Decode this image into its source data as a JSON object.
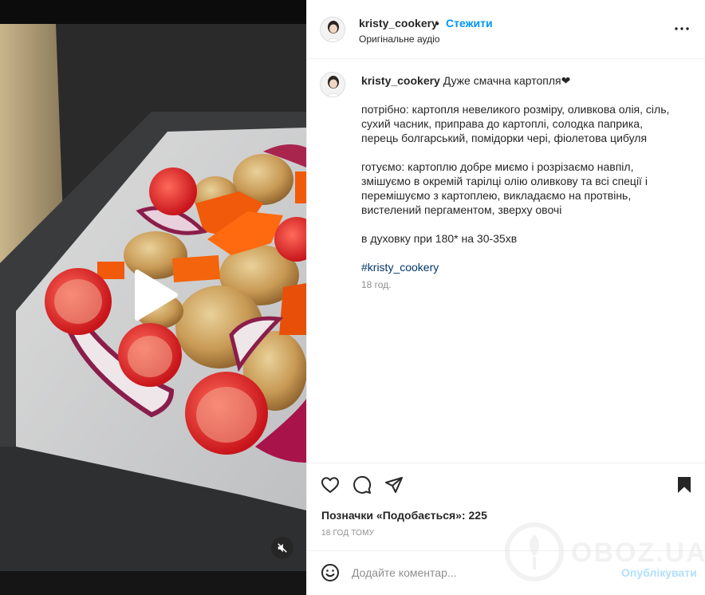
{
  "post": {
    "username": "kristy_cookery",
    "separator": "•",
    "follow_label": "Стежити",
    "audio_label": "Оригінальне аудіо",
    "more_icon": "more-horizontal-icon"
  },
  "caption": {
    "username": "kristy_cookery",
    "title": "Дуже смачна картопля❤",
    "ingredients": "потрібно: картопля невеликого розміру, оливкова олія, сіль, сухий часник, приправа до картоплі, солодка паприка, перець болгарський, помідорки черрі, фіолетова цибуля",
    "ingredients_display": "потрібно: картопля невеликого розміру, оливкова олія, сіль, сухий часник, приправа до картоплі, солодка паприка, перець болгарський, помідорки чері, фіолетова цибуля",
    "method": "готуємо: картоплю добре миємо і розрізаємо навпіл, змішуємо в окремій тарілці олію оливкову та всі спеції і перемішуємо з картоплею, викладаємо на протвінь, вистелений пергаментом, зверху овочі",
    "oven": "в духовку при 180* на 30-35хв",
    "hashtag": "#kristy_cookery",
    "time_ago": "18 год."
  },
  "actions": {
    "likes_label": "Позначки «Подобається»:",
    "likes_count": "225",
    "date_label": "18 ГОД ТОМУ"
  },
  "comment": {
    "placeholder": "Додайте коментар...",
    "publish_label": "Опублікувати"
  },
  "watermark": {
    "text": "OBOZ.UA"
  }
}
